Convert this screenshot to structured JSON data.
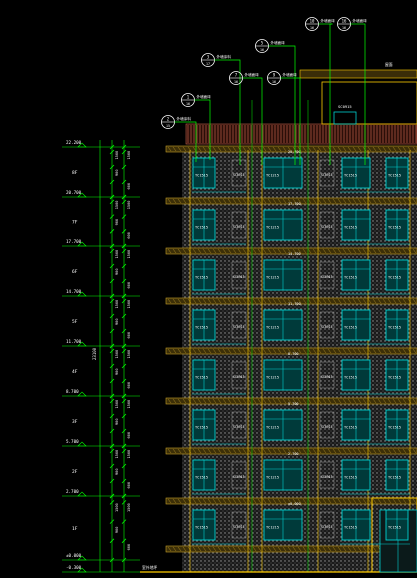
{
  "colors": {
    "background": "#000000",
    "dimension": "#00ff00",
    "axis_line": "#00cc00",
    "facade_outline": "#ffcc00",
    "window_frame": "#00d0d0",
    "glass": "#003a3a",
    "text": "#ffffff",
    "tag_circle": "#ffffff",
    "wall_hatch": "#9a9a9a",
    "slab_band": "#c9a227",
    "parapet_rail": "#c0604a",
    "door_frame": "#ffcc00"
  },
  "elevation_levels": [
    {
      "text": "22.200",
      "value": 22.2
    },
    {
      "text": "20.700",
      "value": 20.7
    },
    {
      "text": "17.700",
      "value": 17.7
    },
    {
      "text": "14.700",
      "value": 14.7
    },
    {
      "text": "11.700",
      "value": 11.7
    },
    {
      "text": "8.700",
      "value": 8.7
    },
    {
      "text": "5.700",
      "value": 5.7
    },
    {
      "text": "2.700",
      "value": 2.7
    },
    {
      "text": "±0.000",
      "value": 0
    },
    {
      "text": "-0.300",
      "value": -0.3
    }
  ],
  "floor_labels": [
    "8F",
    "7F",
    "6F",
    "5F",
    "4F",
    "3F",
    "2F",
    "1F"
  ],
  "dimension_column": {
    "segment_texts": [
      "1500",
      "900",
      "1500",
      "600"
    ],
    "total_text": "23100"
  },
  "window_labels": {
    "left_window": "TC1515",
    "panel": "SC0915",
    "center_window": "TC1215"
  },
  "callout_tags": [
    {
      "top": "1",
      "bottom": "16",
      "label": "外墙面砖"
    },
    {
      "top": "2",
      "bottom": "15",
      "label": "外墙涂料"
    },
    {
      "top": "3",
      "bottom": "17",
      "label": "外墙涂料"
    },
    {
      "top": "7",
      "bottom": "16",
      "label": "外墙面砖"
    },
    {
      "top": "5",
      "bottom": "16",
      "label": "外墙面砖"
    },
    {
      "top": "9",
      "bottom": "16",
      "label": "外墙面砖"
    },
    {
      "top": "10",
      "bottom": "16",
      "label": "外墙面砖"
    },
    {
      "top": "16",
      "bottom": "16",
      "label": "外墙面砖"
    }
  ],
  "roof_label": "屋面",
  "ground_label": "室外地坪"
}
